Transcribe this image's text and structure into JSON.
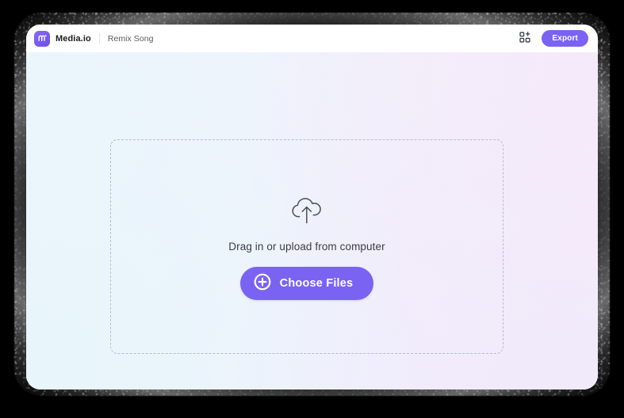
{
  "window": {
    "app_name": "Media.io",
    "page_title": "Remix Song"
  },
  "header": {
    "logo_icon": "media-io-logo-icon",
    "brand_label": "Media.io",
    "title_label": "Remix Song",
    "grid_icon": "grid-apps-icon",
    "export_label": "Export"
  },
  "main": {
    "dropzone": {
      "upload_icon": "cloud-upload-icon",
      "caption": "Drag in or upload from computer",
      "button": {
        "plus_icon": "plus-circle-icon",
        "label": "Choose Files"
      }
    }
  },
  "colors": {
    "accent": "#7a63f2",
    "logo_gradient_start": "#8b6cf5",
    "logo_gradient_end": "#6f4fe8",
    "dropzone_border": "#b9bbd8",
    "caption_text": "#3b3d47",
    "title_text": "#585a63",
    "brand_text": "#1c1d21",
    "canvas_blue": "#eaf6fb",
    "canvas_pink": "#f7ecfa",
    "stage_background": "#000000",
    "window_background": "#ffffff"
  }
}
